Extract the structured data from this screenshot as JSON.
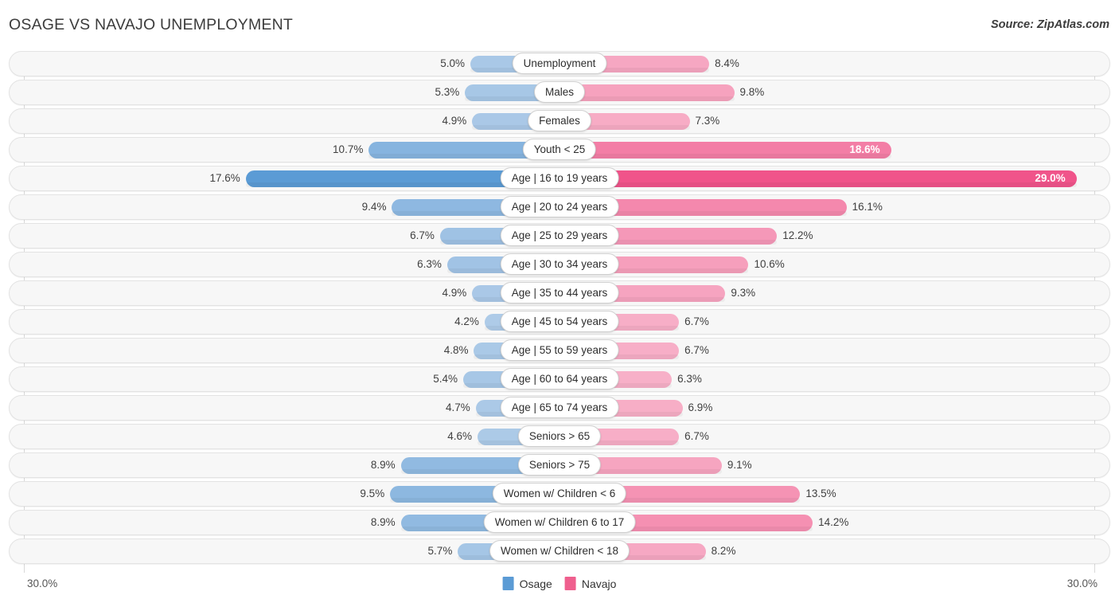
{
  "header": {
    "title": "OSAGE VS NAVAJO UNEMPLOYMENT",
    "source": "Source: ZipAtlas.com"
  },
  "footer": {
    "axis_left": "30.0%",
    "axis_right": "30.0%"
  },
  "legend": {
    "items": [
      {
        "label": "Osage",
        "color": "#5b9bd5"
      },
      {
        "label": "Navajo",
        "color": "#ef5f8e"
      }
    ]
  },
  "colors": {
    "left_min": "#aecbe8",
    "left_max": "#5b9bd5",
    "right_min": "#f7b0c8",
    "right_max": "#f0548a",
    "track_fill": "#f7f7f7",
    "track_border": "#e3e3e3",
    "gridline": "#d8d8d8",
    "title": "#3c3c3c"
  },
  "chart_data": {
    "type": "bar",
    "subtype": "diverging-bidirectional",
    "title": "OSAGE VS NAVAJO UNEMPLOYMENT",
    "xlabel": "",
    "ylabel": "",
    "axis_max": 30.0,
    "axis_left_label": "30.0%",
    "axis_right_label": "30.0%",
    "unit": "%",
    "grid": false,
    "legend_position": "bottom-center",
    "categories": [
      "Unemployment",
      "Males",
      "Females",
      "Youth < 25",
      "Age | 16 to 19 years",
      "Age | 20 to 24 years",
      "Age | 25 to 29 years",
      "Age | 30 to 34 years",
      "Age | 35 to 44 years",
      "Age | 45 to 54 years",
      "Age | 55 to 59 years",
      "Age | 60 to 64 years",
      "Age | 65 to 74 years",
      "Seniors > 65",
      "Seniors > 75",
      "Women w/ Children < 6",
      "Women w/ Children 6 to 17",
      "Women w/ Children < 18"
    ],
    "series": [
      {
        "name": "Osage",
        "side": "left",
        "color": "#5b9bd5",
        "values": [
          5.0,
          5.3,
          4.9,
          10.7,
          17.6,
          9.4,
          6.7,
          6.3,
          4.9,
          4.2,
          4.8,
          5.4,
          4.7,
          4.6,
          8.9,
          9.5,
          8.9,
          5.7
        ],
        "labels": [
          "5.0%",
          "5.3%",
          "4.9%",
          "10.7%",
          "17.6%",
          "9.4%",
          "6.7%",
          "6.3%",
          "4.9%",
          "4.2%",
          "4.8%",
          "5.4%",
          "4.7%",
          "4.6%",
          "8.9%",
          "9.5%",
          "8.9%",
          "5.7%"
        ]
      },
      {
        "name": "Navajo",
        "side": "right",
        "color": "#ef5f8e",
        "values": [
          8.4,
          9.8,
          7.3,
          18.6,
          29.0,
          16.1,
          12.2,
          10.6,
          9.3,
          6.7,
          6.7,
          6.3,
          6.9,
          6.7,
          9.1,
          13.5,
          14.2,
          8.2
        ],
        "labels": [
          "8.4%",
          "9.8%",
          "7.3%",
          "18.6%",
          "29.0%",
          "16.1%",
          "12.2%",
          "10.6%",
          "9.3%",
          "6.7%",
          "6.7%",
          "6.3%",
          "6.9%",
          "6.7%",
          "9.1%",
          "13.5%",
          "14.2%",
          "8.2%"
        ]
      }
    ],
    "rows": [
      {
        "label": "Unemployment",
        "osage": 5.0,
        "navajo": 8.4,
        "osage_label": "5.0%",
        "navajo_label": "8.4%",
        "navajo_label_inside": false
      },
      {
        "label": "Males",
        "osage": 5.3,
        "navajo": 9.8,
        "osage_label": "5.3%",
        "navajo_label": "9.8%",
        "navajo_label_inside": false
      },
      {
        "label": "Females",
        "osage": 4.9,
        "navajo": 7.3,
        "osage_label": "4.9%",
        "navajo_label": "7.3%",
        "navajo_label_inside": false
      },
      {
        "label": "Youth < 25",
        "osage": 10.7,
        "navajo": 18.6,
        "osage_label": "10.7%",
        "navajo_label": "18.6%",
        "navajo_label_inside": true
      },
      {
        "label": "Age | 16 to 19 years",
        "osage": 17.6,
        "navajo": 29.0,
        "osage_label": "17.6%",
        "navajo_label": "29.0%",
        "navajo_label_inside": true
      },
      {
        "label": "Age | 20 to 24 years",
        "osage": 9.4,
        "navajo": 16.1,
        "osage_label": "9.4%",
        "navajo_label": "16.1%",
        "navajo_label_inside": false
      },
      {
        "label": "Age | 25 to 29 years",
        "osage": 6.7,
        "navajo": 12.2,
        "osage_label": "6.7%",
        "navajo_label": "12.2%",
        "navajo_label_inside": false
      },
      {
        "label": "Age | 30 to 34 years",
        "osage": 6.3,
        "navajo": 10.6,
        "osage_label": "6.3%",
        "navajo_label": "10.6%",
        "navajo_label_inside": false
      },
      {
        "label": "Age | 35 to 44 years",
        "osage": 4.9,
        "navajo": 9.3,
        "osage_label": "4.9%",
        "navajo_label": "9.3%",
        "navajo_label_inside": false
      },
      {
        "label": "Age | 45 to 54 years",
        "osage": 4.2,
        "navajo": 6.7,
        "osage_label": "4.2%",
        "navajo_label": "6.7%",
        "navajo_label_inside": false
      },
      {
        "label": "Age | 55 to 59 years",
        "osage": 4.8,
        "navajo": 6.7,
        "osage_label": "4.8%",
        "navajo_label": "6.7%",
        "navajo_label_inside": false
      },
      {
        "label": "Age | 60 to 64 years",
        "osage": 5.4,
        "navajo": 6.3,
        "osage_label": "5.4%",
        "navajo_label": "6.3%",
        "navajo_label_inside": false
      },
      {
        "label": "Age | 65 to 74 years",
        "osage": 4.7,
        "navajo": 6.9,
        "osage_label": "4.7%",
        "navajo_label": "6.9%",
        "navajo_label_inside": false
      },
      {
        "label": "Seniors > 65",
        "osage": 4.6,
        "navajo": 6.7,
        "osage_label": "4.6%",
        "navajo_label": "6.7%",
        "navajo_label_inside": false
      },
      {
        "label": "Seniors > 75",
        "osage": 8.9,
        "navajo": 9.1,
        "osage_label": "8.9%",
        "navajo_label": "9.1%",
        "navajo_label_inside": false
      },
      {
        "label": "Women w/ Children < 6",
        "osage": 9.5,
        "navajo": 13.5,
        "osage_label": "9.5%",
        "navajo_label": "13.5%",
        "navajo_label_inside": false
      },
      {
        "label": "Women w/ Children 6 to 17",
        "osage": 8.9,
        "navajo": 14.2,
        "osage_label": "8.9%",
        "navajo_label": "14.2%",
        "navajo_label_inside": false
      },
      {
        "label": "Women w/ Children < 18",
        "osage": 5.7,
        "navajo": 8.2,
        "osage_label": "5.7%",
        "navajo_label": "8.2%",
        "navajo_label_inside": false
      }
    ]
  }
}
